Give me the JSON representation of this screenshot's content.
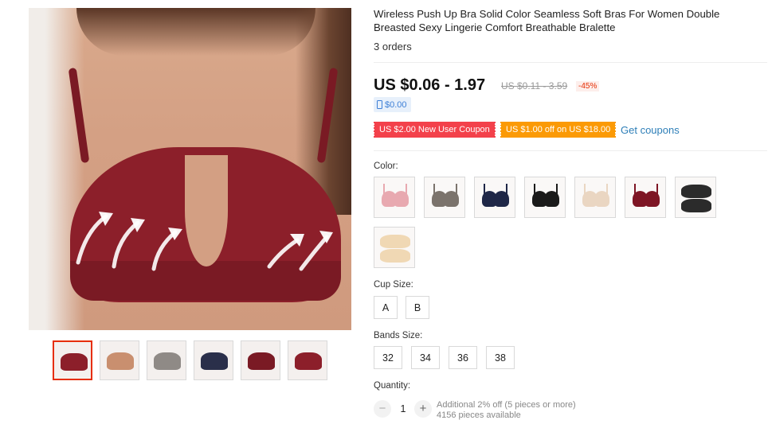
{
  "product": {
    "title": "Wireless Push Up Bra Solid Color Seamless Soft Bras For Women Double Breasted Sexy Lingerie Comfort Breathable Bralette",
    "orders": "3 orders"
  },
  "pricing": {
    "price": "US $0.06 - 1.97",
    "original_price": "US $0.11 - 3.59",
    "discount": "-45%",
    "mobile_price": "$0.00"
  },
  "coupons": {
    "new_user": "US $2.00 New User Coupon",
    "store": "US $1.00 off on US $18.00",
    "get_coupons": "Get coupons"
  },
  "gallery": {
    "thumbnails": [
      {
        "color": "#8c1f2a"
      },
      {
        "color": "#c98f6f"
      },
      {
        "color": "#8f8a86"
      },
      {
        "color": "#2a2f4a"
      },
      {
        "color": "#7a1a24"
      },
      {
        "color": "#8c1f2a"
      }
    ]
  },
  "options": {
    "color_label": "Color:",
    "colors": [
      {
        "name": "pink",
        "hex": "#e8a9b0"
      },
      {
        "name": "gray",
        "hex": "#7b736c"
      },
      {
        "name": "navy",
        "hex": "#1f2747"
      },
      {
        "name": "black",
        "hex": "#1a1a1a"
      },
      {
        "name": "beige",
        "hex": "#ead6c2"
      },
      {
        "name": "wine",
        "hex": "#7e1524"
      },
      {
        "name": "black-pads",
        "hex": "#2b2b2b"
      },
      {
        "name": "beige-pads",
        "hex": "#f0d8b4"
      }
    ],
    "cup_label": "Cup Size:",
    "cups": [
      "A",
      "B"
    ],
    "band_label": "Bands Size:",
    "bands": [
      "32",
      "34",
      "36",
      "38"
    ],
    "quantity_label": "Quantity:",
    "quantity": "1",
    "quantity_minus": "−",
    "quantity_plus": "+",
    "bulk_note": "Additional 2% off (5 pieces or more)",
    "available": "4156 pieces available"
  },
  "colors": {
    "accent": "#e62e04",
    "coupon_red": "#f3414b",
    "coupon_orange": "#fb9a06",
    "link": "#2e7fb8"
  }
}
